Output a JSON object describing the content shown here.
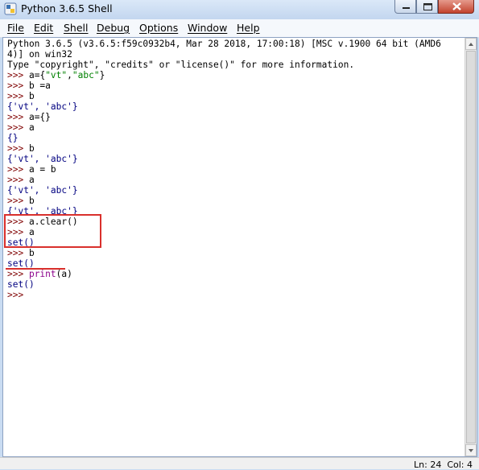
{
  "window": {
    "title": "Python 3.6.5 Shell",
    "icon": "python-idle-icon",
    "controls": [
      "minimize-icon",
      "maximize-icon",
      "close-icon"
    ]
  },
  "menu": {
    "items": [
      {
        "label": "File"
      },
      {
        "label": "Edit"
      },
      {
        "label": "Shell"
      },
      {
        "label": "Debug"
      },
      {
        "label": "Options"
      },
      {
        "label": "Window"
      },
      {
        "label": "Help"
      }
    ]
  },
  "shell": {
    "banner": [
      "Python 3.6.5 (v3.6.5:f59c0932b4, Mar 28 2018, 17:00:18) [MSC v.1900 64 bit (AMD6",
      "4)] on win32",
      "Type \"copyright\", \"credits\" or \"license()\" for more information."
    ],
    "prompt": ">>> ",
    "lines": [
      {
        "kind": "input",
        "segments": [
          {
            "text": "a="
          },
          {
            "text": "{",
            "cls": ""
          },
          {
            "text": "\"vt\"",
            "cls": "str"
          },
          {
            "text": ","
          },
          {
            "text": "\"abc\"",
            "cls": "str"
          },
          {
            "text": "}"
          }
        ]
      },
      {
        "kind": "input",
        "segments": [
          {
            "text": "b =a"
          }
        ]
      },
      {
        "kind": "input",
        "segments": [
          {
            "text": "b"
          }
        ]
      },
      {
        "kind": "output",
        "text": "{'vt', 'abc'}"
      },
      {
        "kind": "input",
        "segments": [
          {
            "text": "a={}"
          }
        ]
      },
      {
        "kind": "input",
        "segments": [
          {
            "text": "a"
          }
        ]
      },
      {
        "kind": "output",
        "text": "{}"
      },
      {
        "kind": "input",
        "segments": [
          {
            "text": "b"
          }
        ]
      },
      {
        "kind": "output",
        "text": "{'vt', 'abc'}"
      },
      {
        "kind": "input",
        "segments": [
          {
            "text": "a = b"
          }
        ]
      },
      {
        "kind": "input",
        "segments": [
          {
            "text": "a"
          }
        ]
      },
      {
        "kind": "output",
        "text": "{'vt', 'abc'}"
      },
      {
        "kind": "input",
        "segments": [
          {
            "text": "b"
          }
        ]
      },
      {
        "kind": "output",
        "text": "{'vt', 'abc'}"
      },
      {
        "kind": "input",
        "segments": [
          {
            "text": "a.clear()"
          }
        ]
      },
      {
        "kind": "input",
        "segments": [
          {
            "text": "a"
          }
        ]
      },
      {
        "kind": "output",
        "text": "set()"
      },
      {
        "kind": "input",
        "segments": [
          {
            "text": "b"
          }
        ]
      },
      {
        "kind": "output",
        "text": "set()"
      },
      {
        "kind": "input",
        "segments": [
          {
            "text": "print",
            "cls": "builtin"
          },
          {
            "text": "(a)"
          }
        ]
      },
      {
        "kind": "output",
        "text": "set()"
      },
      {
        "kind": "prompt-only",
        "segments": []
      }
    ]
  },
  "status": {
    "line_label": "Ln: 24",
    "col_label": "Col: 4"
  },
  "colors": {
    "annotation": "#d9302c",
    "prompt": "#7f0000",
    "output": "#000080",
    "string": "#008000"
  }
}
